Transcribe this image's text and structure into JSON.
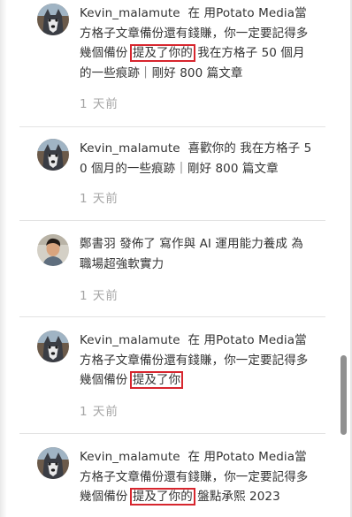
{
  "notifications": [
    {
      "user": "Kevin_malamute",
      "avatar": "husky-avatar",
      "pre": "在 用Potato Media當方格子文章備份還有錢賺，你一定要記得多幾個備份",
      "highlight": "提及了你的",
      "post": "我在方格子 50 個月的一些痕跡｜剛好 800 篇文章",
      "time": "1 天前"
    },
    {
      "user": "Kevin_malamute",
      "avatar": "husky-avatar",
      "pre": "喜歡你的 我在方格子 50 個月的一些痕跡｜剛好 800 篇文章",
      "highlight": "",
      "post": "",
      "time": "1 天前"
    },
    {
      "user": "鄭書羽",
      "avatar": "person-avatar",
      "pre": "發佈了 寫作與 AI 運用能力養成 為職場超強軟實力",
      "highlight": "",
      "post": "",
      "time": "1 天前"
    },
    {
      "user": "Kevin_malamute",
      "avatar": "husky-avatar",
      "pre": "在 用Potato Media當方格子文章備份還有錢賺，你一定要記得多幾個備份",
      "highlight": "提及了你",
      "post": "",
      "time": "1 天前"
    },
    {
      "user": "Kevin_malamute",
      "avatar": "husky-avatar",
      "pre": "在 用Potato Media當方格子文章備份還有錢賺，你一定要記得多幾個備份",
      "highlight": "提及了你的",
      "post": "盤點承熙 2023",
      "time": ""
    }
  ],
  "colors": {
    "highlight_border": "#d7262e",
    "time_text": "#a5a5a5",
    "body_text": "#333333",
    "divider": "#e3e3e3",
    "scrollbar_thumb": "#909090"
  }
}
